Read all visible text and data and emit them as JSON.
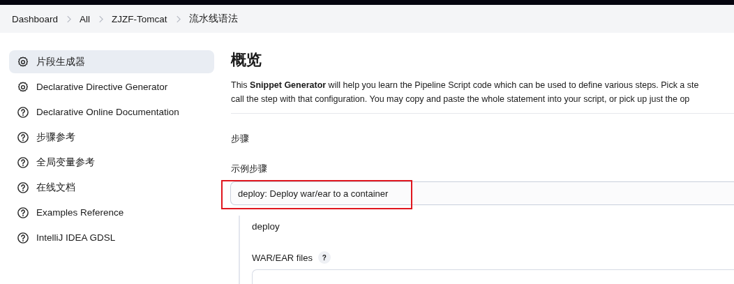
{
  "breadcrumbs": [
    "Dashboard",
    "All",
    "ZJZF-Tomcat",
    "流水线语法"
  ],
  "sidebar": {
    "items": [
      {
        "label": "片段生成器",
        "kind": "tool",
        "selected": true
      },
      {
        "label": "Declarative Directive Generator",
        "kind": "tool",
        "selected": false
      },
      {
        "label": "Declarative Online Documentation",
        "kind": "doc",
        "selected": false
      },
      {
        "label": "步骤参考",
        "kind": "doc",
        "selected": false
      },
      {
        "label": "全局变量参考",
        "kind": "doc",
        "selected": false
      },
      {
        "label": "在线文档",
        "kind": "doc",
        "selected": false
      },
      {
        "label": "Examples Reference",
        "kind": "doc",
        "selected": false
      },
      {
        "label": "IntelliJ IDEA GDSL",
        "kind": "doc",
        "selected": false
      }
    ]
  },
  "main": {
    "title": "概览",
    "description": "This **Snippet Generator** will help you learn the Pipeline Script code which can be used to define various steps. Pick a ste\ncall the step with that configuration. You may copy and paste the whole statement into your script, or pick up just the op",
    "section_label": "步骤",
    "sample_step": {
      "label": "示例步骤",
      "value": "deploy: Deploy war/ear to a container",
      "highlighted": true
    },
    "step_config": {
      "name": "deploy",
      "fields": [
        {
          "label": "WAR/EAR files",
          "help": "?"
        }
      ]
    }
  }
}
